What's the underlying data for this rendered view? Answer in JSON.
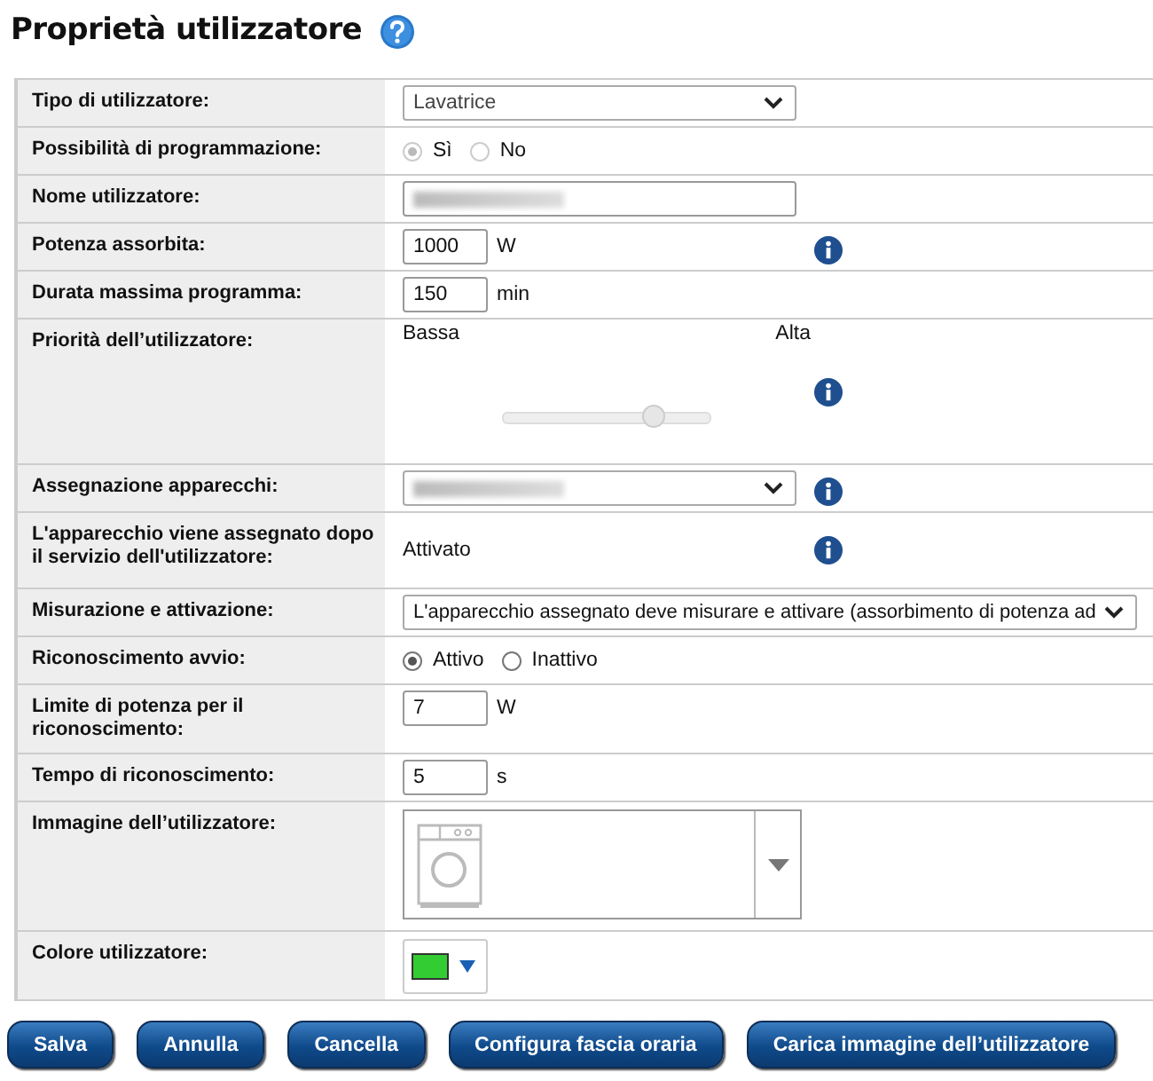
{
  "title": "Proprietà utilizzatore",
  "rows": [
    {
      "kind": "select",
      "label": "Tipo di utilizzatore:",
      "value": "Lavatrice"
    },
    {
      "kind": "radio",
      "label": "Possibilità di programmazione:",
      "disabled": true,
      "options": [
        {
          "label": "Sì",
          "selected": true
        },
        {
          "label": "No",
          "selected": false
        }
      ]
    },
    {
      "kind": "text",
      "label": "Nome utilizzatore:",
      "blurred": true
    },
    {
      "kind": "number",
      "label": "Potenza assorbita:",
      "value": "1000",
      "unit": "W",
      "info": true
    },
    {
      "kind": "number",
      "label": "Durata massima programma:",
      "value": "150",
      "unit": "min"
    },
    {
      "kind": "slider",
      "label": "Priorità dell’utilizzatore:",
      "low": "Bassa",
      "high": "Alta",
      "level": 0.73,
      "info": true
    },
    {
      "kind": "select",
      "label": "Assegnazione apparecchi:",
      "blurred": true,
      "info": true
    },
    {
      "kind": "plain",
      "label": "L'apparecchio viene assegnato dopo il servizio dell'utilizzatore:",
      "value": "Attivato",
      "info": true
    },
    {
      "kind": "wide-select",
      "label": "Misurazione e attivazione:",
      "value": "L'apparecchio assegnato deve misurare e attivare (assorbimento di potenza ad"
    },
    {
      "kind": "radio",
      "label": "Riconoscimento avvio:",
      "disabled": false,
      "options": [
        {
          "label": "Attivo",
          "selected": true
        },
        {
          "label": "Inattivo",
          "selected": false
        }
      ]
    },
    {
      "kind": "number",
      "label": "Limite di potenza per il riconoscimento:",
      "value": "7",
      "unit": "W"
    },
    {
      "kind": "number",
      "label": "Tempo di riconoscimento:",
      "value": "5",
      "unit": "s"
    },
    {
      "kind": "image",
      "label": "Immagine dell’utilizzatore:"
    },
    {
      "kind": "color",
      "label": "Colore utilizzatore:",
      "color": "#33cc33"
    }
  ],
  "buttons": [
    "Salva",
    "Annulla",
    "Cancella",
    "Configura fascia oraria",
    "Carica immagine dell’utilizzatore"
  ]
}
